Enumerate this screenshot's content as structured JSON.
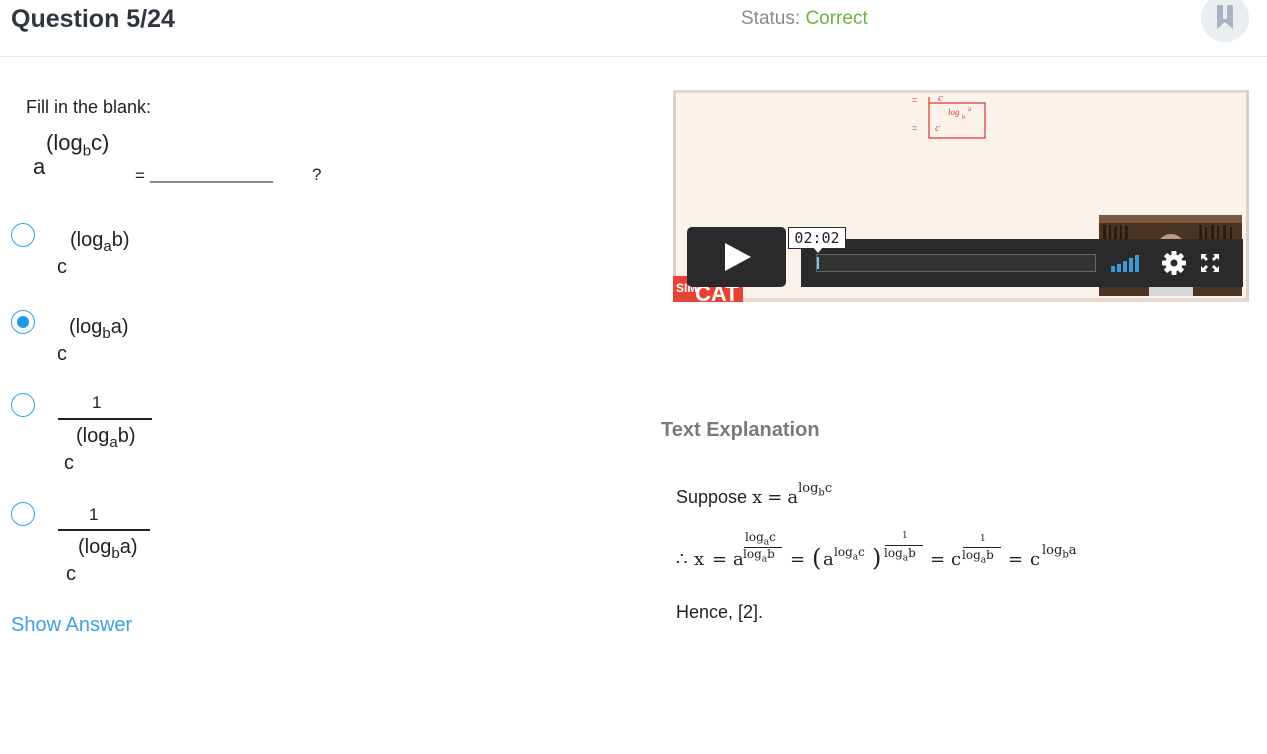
{
  "header": {
    "question_title": "Question 5/24",
    "status_label": "Status:",
    "status_value": "Correct",
    "status_color": "#6db33f",
    "bookmark_icon": "bookmark-icon"
  },
  "question": {
    "instruction": "Fill in the blank:",
    "base": "a",
    "exponent": "(log",
    "exponent_sub": "b",
    "exponent_end": "c)",
    "equals": "=",
    "blank": "_____________",
    "qmark": "?"
  },
  "options": [
    {
      "selected": false,
      "base": "c",
      "exp": "(log",
      "sub": "a",
      "exp_end": "b)"
    },
    {
      "selected": true,
      "base": "c",
      "exp": "(log",
      "sub": "b",
      "exp_end": "a)"
    },
    {
      "selected": false,
      "numerator": "1",
      "base": "c",
      "exp": "(log",
      "sub": "a",
      "exp_end": "b)"
    },
    {
      "selected": false,
      "numerator": "1",
      "base": "c",
      "exp": "(log",
      "sub": "b",
      "exp_end": "a)"
    }
  ],
  "show_answer": "Show Answer",
  "video": {
    "time_tooltip": "02:02",
    "logo_text": "SIM",
    "logo_text2": "CAT",
    "progress_fraction": 0.005,
    "play_icon": "play-icon",
    "volume_icon": "volume-bars-icon",
    "settings_icon": "gear-icon",
    "fullscreen_icon": "fullscreen-icon",
    "whiteboard_lines": [
      "c",
      "log",
      "b",
      "a",
      "c"
    ],
    "accent_color": "#3b9bd8"
  },
  "explanation": {
    "title": "Text Explanation",
    "line1_prefix": "Suppose",
    "line1_math_x": "x",
    "line1_math_eq": "=",
    "line1_math_a": "a",
    "line1_math_exp": "log",
    "line1_math_exp_sub": "b",
    "line1_math_exp_end": "c",
    "line2": {
      "therefore": "∴",
      "x": "x",
      "eq": "=",
      "a": "a",
      "frac_num": "log",
      "frac_num_sub": "a",
      "frac_num_end": "c",
      "frac_den": "log",
      "frac_den_sub": "a",
      "frac_den_end": "b",
      "paren_open": "(",
      "paren_a": "a",
      "paren_exp": "log",
      "paren_exp_sub": "a",
      "paren_exp_end": "c",
      "paren_close": ")",
      "outer_num": "1",
      "outer_den": "log",
      "outer_den_sub": "a",
      "outer_den_end": "b",
      "c1": "c",
      "c1_num": "1",
      "c1_den": "log",
      "c1_den_sub": "a",
      "c1_den_end": "b",
      "c2": "c",
      "c2_exp": "log",
      "c2_exp_sub": "b",
      "c2_exp_end": "a"
    },
    "line3": "Hence, [2]."
  }
}
